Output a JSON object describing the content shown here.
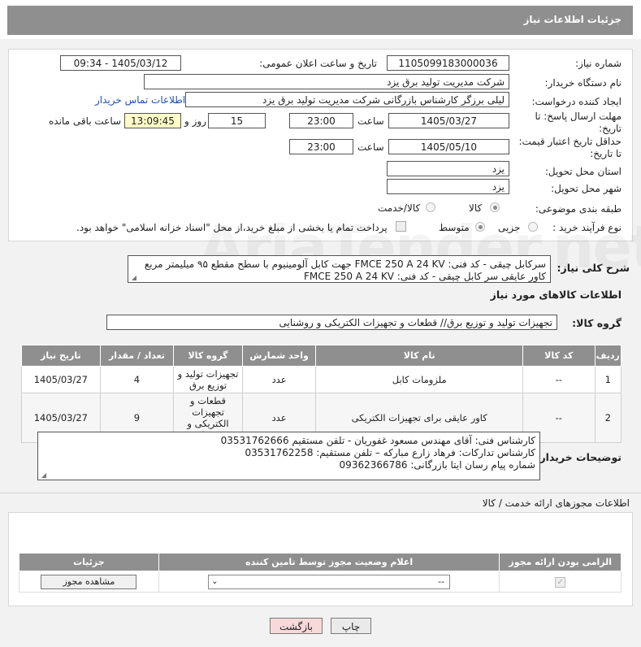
{
  "header": {
    "title": "جزئیات اطلاعات نیاز"
  },
  "form": {
    "need_number_label": "شماره نیاز:",
    "need_number": "1105099183000036",
    "announce_label": "تاریخ و ساعت اعلان عمومی:",
    "announce_value": "1405/03/12 - 09:34",
    "buyer_org_label": "نام دستگاه خریدار:",
    "buyer_org": "شرکت مدیریت تولید برق یزد",
    "creator_label": "ایجاد کننده درخواست:",
    "creator": "لیلی برزگر کارشناس بازرگانی شرکت مدیریت تولید برق یزد",
    "contact_link": "اطلاعات تماس خریدار",
    "deadline_label_1": "مهلت ارسال پاسخ: تا",
    "deadline_label_2": "تاریخ:",
    "deadline_date": "1405/03/27",
    "time_label": "ساعت",
    "deadline_time": "23:00",
    "days_value": "15",
    "days_label": "روز و",
    "remaining_value": "13:09:45",
    "remaining_label": "ساعت باقی مانده",
    "validity_label_1": "حداقل تاریخ اعتبار قیمت:",
    "validity_label_2": "تا تاریخ:",
    "validity_date": "1405/05/10",
    "validity_time": "23:00",
    "province_label": "استان محل تحویل:",
    "province": "یزد",
    "city_label": "شهر محل تحویل:",
    "city": "یزد",
    "category_label": "طبقه بندی موضوعی:",
    "category_options": [
      "کالا",
      "کالا/خدمت"
    ],
    "category_selected": "کالا",
    "purchase_type_label": "نوع فرآیند خرید :",
    "purchase_options": [
      "جزیی",
      "متوسط"
    ],
    "purchase_selected": "متوسط",
    "payment_note": "پرداخت تمام یا بخشی از مبلغ خرید،از محل \"اسناد خزانه اسلامی\" خواهد بود."
  },
  "description": {
    "label": "شرح کلی نیاز:",
    "line1": "سرکابل چیقی - کد فنی: FMCE 250 A 24 KV جهت کابل آلومینیوم با سطح مقطع ۹۵ میلیمتر مربع",
    "line2": "کاور عایقی سر کابل چیقی - کد فنی: FMCE 250 A 24 KV"
  },
  "goods": {
    "section_title": "اطلاعات کالاهای مورد نیاز",
    "group_label": "گروه کالا:",
    "group_value": "تجهیزات تولید و توزیع برق// قطعات و تجهیزات الکتریکی و روشنایی",
    "columns": [
      "ردیف",
      "کد کالا",
      "نام کالا",
      "واحد شمارش",
      "گروه کالا",
      "تعداد / مقدار",
      "تاریخ نیاز"
    ],
    "rows": [
      {
        "index": "1",
        "code": "--",
        "name": "ملزومات کابل",
        "unit": "عدد",
        "group": "تجهیزات تولید و توزیع برق",
        "qty": "4",
        "date": "1405/03/27"
      },
      {
        "index": "2",
        "code": "--",
        "name": "کاور عایقی برای تجهیزات الکتریکی",
        "unit": "عدد",
        "group": "قطعات و تجهیزات الکتریکی و روشنایی",
        "qty": "9",
        "date": "1405/03/27"
      }
    ]
  },
  "buyer_notes": {
    "label": "توضیحات خریدار:",
    "line1": "کارشناس فنی: آقای مهندس مسعود غفوریان - تلفن مستقیم 03531762666",
    "line2": "کارشناس تدارکات: فرهاد زارع مبارکه –  تلفن مستقیم: 03531762258",
    "line3": "شماره پیام رسان ایتا بازرگانی: 09362366786"
  },
  "permits": {
    "section_title": "اطلاعات مجوزهای ارائه خدمت / کالا",
    "columns": [
      "الزامی بودن ارائه مجوز",
      "اعلام وضعیت مجوز توسط تامین کننده",
      "جزئیات"
    ],
    "select_value": "--",
    "view_button": "مشاهده مجوز"
  },
  "footer": {
    "print_button": "چاپ",
    "back_button": "بازگشت"
  },
  "colors": {
    "header_bg": "#8f8f8f",
    "link": "#1f4fb8",
    "highlight": "#ffffc8",
    "back_button_bg": "#f7d9d9"
  }
}
